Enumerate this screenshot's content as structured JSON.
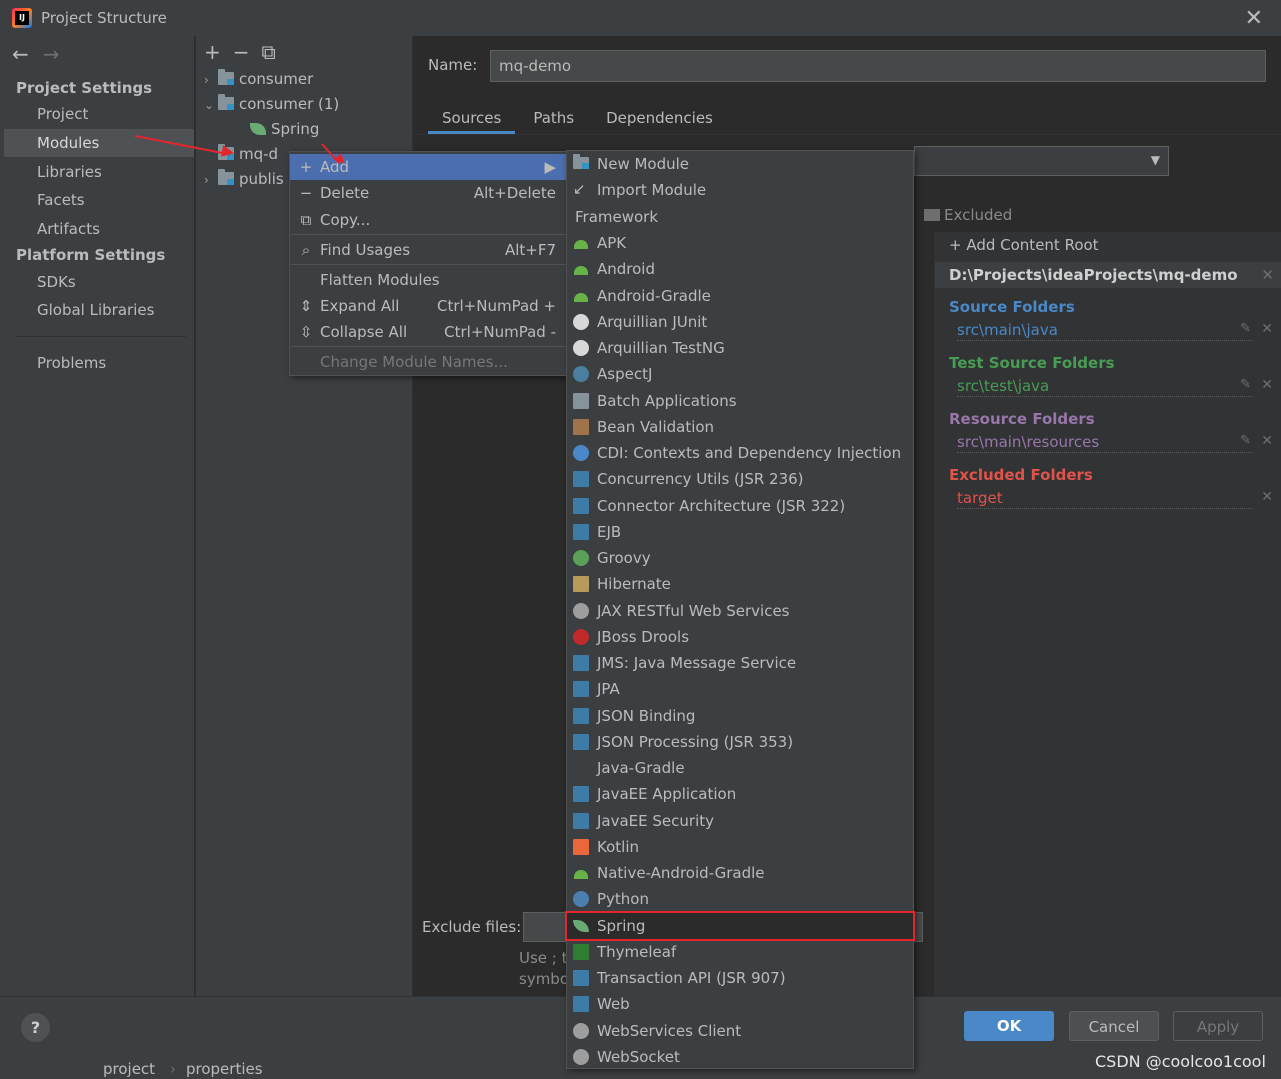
{
  "window": {
    "title": "Project Structure",
    "close_glyph": "✕"
  },
  "nav": {
    "back_glyph": "←",
    "forward_glyph": "→",
    "project_settings_header": "Project Settings",
    "project_settings_items": [
      "Project",
      "Modules",
      "Libraries",
      "Facets",
      "Artifacts"
    ],
    "selected": "Modules",
    "platform_settings_header": "Platform Settings",
    "platform_settings_items": [
      "SDKs",
      "Global Libraries"
    ],
    "problems": "Problems"
  },
  "tree": {
    "toolbar": {
      "add": "+",
      "remove": "−",
      "copy": "⧉"
    },
    "rows": [
      {
        "label": "consumer",
        "icon": "module-folder-icon",
        "expanded": false
      },
      {
        "label": "consumer (1)",
        "icon": "module-folder-icon",
        "expanded": true
      },
      {
        "label": "Spring",
        "icon": "spring-leaf-icon"
      },
      {
        "label": "mq-d",
        "icon": "module-folder-icon"
      },
      {
        "label": "publis",
        "icon": "module-folder-icon",
        "expanded": false
      }
    ]
  },
  "main": {
    "name_label": "Name:",
    "name_value": "mq-demo",
    "tabs": [
      "Sources",
      "Paths",
      "Dependencies"
    ],
    "active_tab": "Sources",
    "excluded_label": "Excluded",
    "add_content_root": "Add Content Root",
    "content_root_path": "D:\\Projects\\ideaProjects\\mq-demo",
    "source_folders_header": "Source Folders",
    "source_folder": "src\\main\\java",
    "test_source_folders_header": "Test Source Folders",
    "test_source_folder": "src\\test\\java",
    "resource_folders_header": "Resource Folders",
    "resource_folder": "src\\main\\resources",
    "excluded_folders_header": "Excluded Folders",
    "excluded_folder": "target",
    "exclude_files_label": "Exclude files:",
    "hint_line1": "Use ; t",
    "hint_line2": "symbo"
  },
  "colors": {
    "source": "#4a88c7",
    "test": "#499c54",
    "resource": "#9876aa",
    "excluded": "#e0534a",
    "accent": "#4a88c7",
    "highlight_border": "#e3262b"
  },
  "context_menu": {
    "items": [
      {
        "label": "Add",
        "icon": "plus-icon",
        "shortcut": "",
        "has_submenu": true
      },
      {
        "label": "Delete",
        "icon": "minus-icon",
        "shortcut": "Alt+Delete"
      },
      {
        "label": "Copy...",
        "icon": "copy-icon",
        "shortcut": ""
      },
      {
        "label": "Find Usages",
        "icon": "search-icon",
        "shortcut": "Alt+F7"
      },
      {
        "label": "Flatten Modules",
        "icon": "",
        "shortcut": ""
      },
      {
        "label": "Expand All",
        "icon": "expand-all-icon",
        "shortcut": "Ctrl+NumPad +"
      },
      {
        "label": "Collapse All",
        "icon": "collapse-all-icon",
        "shortcut": "Ctrl+NumPad -"
      },
      {
        "label": "Change Module Names...",
        "icon": "",
        "shortcut": "",
        "disabled": true
      }
    ]
  },
  "submenu": {
    "new_module": "New Module",
    "import_module": "Import Module",
    "framework_header": "Framework",
    "frameworks": [
      "APK",
      "Android",
      "Android-Gradle",
      "Arquillian JUnit",
      "Arquillian TestNG",
      "AspectJ",
      "Batch Applications",
      "Bean Validation",
      "CDI: Contexts and Dependency Injection",
      "Concurrency Utils (JSR 236)",
      "Connector Architecture (JSR 322)",
      "EJB",
      "Groovy",
      "Hibernate",
      "JAX RESTful Web Services",
      "JBoss Drools",
      "JMS: Java Message Service",
      "JPA",
      "JSON Binding",
      "JSON Processing (JSR 353)",
      "Java-Gradle",
      "JavaEE Application",
      "JavaEE Security",
      "Kotlin",
      "Native-Android-Gradle",
      "Python",
      "Spring",
      "Thymeleaf",
      "Transaction API (JSR 907)",
      "Web",
      "WebServices Client",
      "WebSocket"
    ],
    "highlighted": "Spring"
  },
  "footer": {
    "help": "?",
    "ok": "OK",
    "cancel": "Cancel",
    "apply": "Apply"
  },
  "status": {
    "crumb1": "project",
    "crumb2": "properties"
  },
  "watermark": "CSDN @coolcoo1cool"
}
